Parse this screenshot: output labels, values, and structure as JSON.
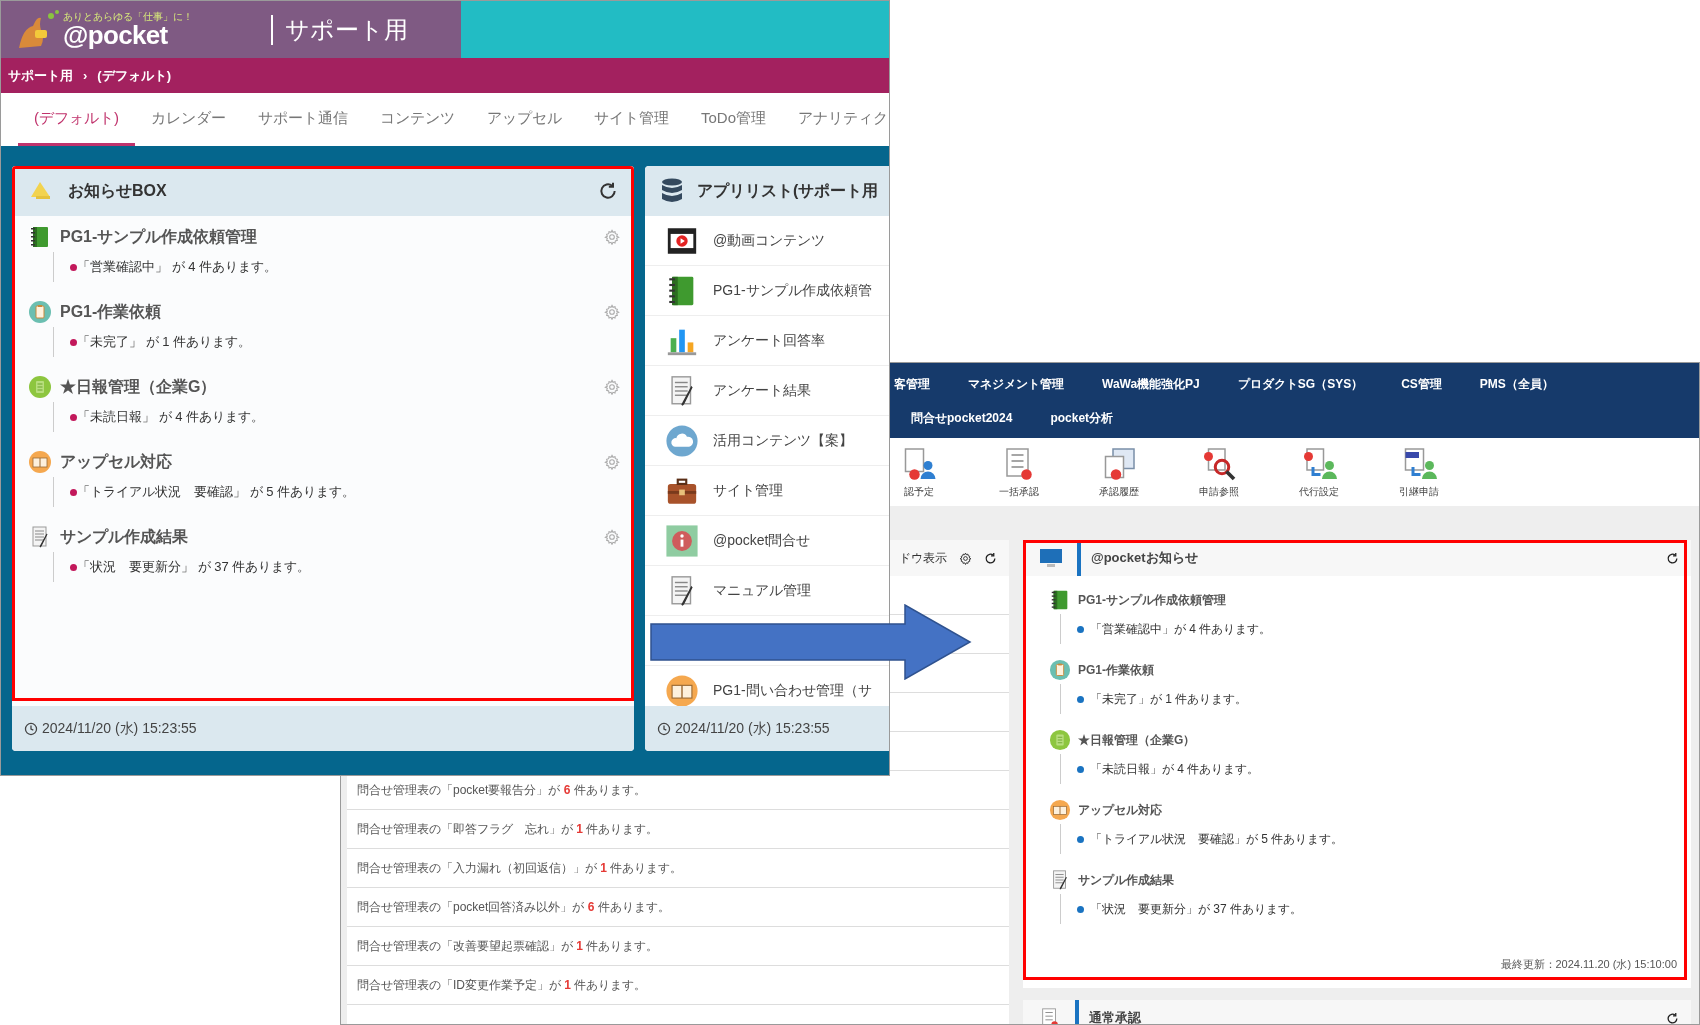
{
  "left_screen": {
    "logo": {
      "tagline": "ありとあらゆる「仕事」に！",
      "name": "@pocket"
    },
    "site_title": "サポート用",
    "breadcrumb": [
      "サポート用",
      "(デフォルト)"
    ],
    "breadcrumb_separator": "›",
    "tabs": [
      {
        "label": "(デフォルト)",
        "selected": true
      },
      {
        "label": "カレンダー",
        "selected": false
      },
      {
        "label": "サポート通信",
        "selected": false
      },
      {
        "label": "コンテンツ",
        "selected": false
      },
      {
        "label": "アップセル",
        "selected": false
      },
      {
        "label": "サイト管理",
        "selected": false
      },
      {
        "label": "ToDo管理",
        "selected": false
      },
      {
        "label": "アナリティク",
        "selected": false
      }
    ],
    "notice_box": {
      "title": "お知らせBOX",
      "items": [
        {
          "kind": "notebook",
          "title": "PG1-サンプル作成依頼管理",
          "message": "「営業確認中」 が 4 件あります。"
        },
        {
          "kind": "clipboard",
          "title": "PG1-作業依頼",
          "message": "「未完了」 が 1 件あります。"
        },
        {
          "kind": "sheet",
          "title": "★日報管理（企業G）",
          "message": "「未読日報」 が 4 件あります。"
        },
        {
          "kind": "book",
          "title": "アップセル対応",
          "message": "「トライアル状況　要確認」 が 5 件あります。"
        },
        {
          "kind": "memo",
          "title": "サンプル作成結果",
          "message": "「状況　要更新分」 が 37 件あります。"
        }
      ],
      "timestamp": "2024/11/20 (水) 15:23:55"
    },
    "app_list": {
      "title": "アプリリスト(サポート用",
      "apps": [
        {
          "kind": "video",
          "label": "@動画コンテンツ"
        },
        {
          "kind": "notebook",
          "label": "PG1-サンプル作成依頼管"
        },
        {
          "kind": "chart",
          "label": "アンケート回答率"
        },
        {
          "kind": "memo",
          "label": "アンケート結果"
        },
        {
          "kind": "cloud",
          "label": "活用コンテンツ【案】"
        },
        {
          "kind": "briefcase",
          "label": "サイト管理"
        },
        {
          "kind": "info",
          "label": "@pocket問合せ"
        },
        {
          "kind": "memo",
          "label": "マニュアル管理"
        },
        {
          "kind": "hidden"
        },
        {
          "kind": "book",
          "label": "PG1-問い合わせ管理（サ"
        }
      ],
      "timestamp": "2024/11/20 (水) 15:23:55"
    }
  },
  "right_screen": {
    "nav_rows": [
      [
        "客管理",
        "マネジメント管理",
        "WaWa機能強化PJ",
        "プロダクトSG（SYS）",
        "CS管理",
        "PMS（全員）"
      ],
      [
        "問合せpocket2024",
        "pocket分析"
      ]
    ],
    "toolbar": [
      {
        "kind": "person",
        "label": "認予定"
      },
      {
        "kind": "list",
        "label": "一括承認"
      },
      {
        "kind": "tray",
        "label": "承認履歴"
      },
      {
        "kind": "search",
        "label": "申請参照"
      },
      {
        "kind": "delegate",
        "label": "代行設定"
      },
      {
        "kind": "handover",
        "label": "引継申請"
      }
    ],
    "window_panel": {
      "title": "ドウ表示",
      "rows": [
        {
          "before": "問合せ管理表の「pocket要報告分」が ",
          "count": "6",
          "after": " 件あります。"
        },
        {
          "before": "問合せ管理表の「即答フラグ　忘れ」が ",
          "count": "1",
          "after": " 件あります。"
        },
        {
          "before": "問合せ管理表の「入力漏れ（初回返信）」が ",
          "count": "1",
          "after": " 件あります。"
        },
        {
          "before": "問合せ管理表の「pocket回答済み以外」が ",
          "count": "6",
          "after": " 件あります。"
        },
        {
          "before": "問合せ管理表の「改善要望起票確認」が ",
          "count": "1",
          "after": " 件あります。"
        },
        {
          "before": "問合せ管理表の「ID変更作業予定」が ",
          "count": "1",
          "after": " 件あります。"
        }
      ]
    },
    "notice_panel": {
      "title": "@pocketお知らせ",
      "items": [
        {
          "kind": "notebook",
          "title": "PG1-サンプル作成依頼管理",
          "message": "「営業確認中」が 4 件あります。"
        },
        {
          "kind": "clipboard",
          "title": "PG1-作業依頼",
          "message": "「未完了」が 1 件あります。"
        },
        {
          "kind": "sheet",
          "title": "★日報管理（企業G）",
          "message": "「未読日報」が 4 件あります。"
        },
        {
          "kind": "book",
          "title": "アップセル対応",
          "message": "「トライアル状況　要確認」が 5 件あります。"
        },
        {
          "kind": "memo",
          "title": "サンプル作成結果",
          "message": "「状況　要更新分」が 37 件あります。"
        }
      ],
      "last_updated": "最終更新：2024.11.20 (水) 15:10:00"
    },
    "approval_panel": {
      "title": "通常承認"
    }
  }
}
